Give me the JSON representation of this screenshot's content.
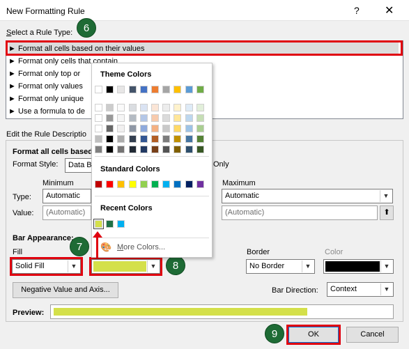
{
  "dialog": {
    "title": "New Formatting Rule",
    "help": "?",
    "close": "✕"
  },
  "select_rule": {
    "label": "Select a Rule Type:",
    "rules": [
      "► Format all cells based on their values",
      "► Format only cells that contain",
      "► Format only top or",
      "► Format only values",
      "► Format only unique",
      "► Use a formula to de"
    ]
  },
  "edit": {
    "label": "Edit the Rule Descriptio",
    "heading": "Format all cells based",
    "format_style_label": "Format Style:",
    "format_style_value": "Data B",
    "only_text": "Only",
    "minimum_label": "Minimum",
    "maximum_label": "Maximum",
    "type_label": "Type:",
    "min_type": "Automatic",
    "max_type": "Automatic",
    "value_label": "Value:",
    "min_value": "(Automatic)",
    "max_value": "(Automatic)",
    "bar_appearance": "Bar Appearance:",
    "fill_label": "Fill",
    "fill_value": "Solid Fill",
    "border_label": "Border",
    "border_value": "No Border",
    "color_label": "Color",
    "negative_button": "Negative Value and Axis...",
    "bar_direction_label": "Bar Direction:",
    "bar_direction_value": "Context",
    "preview_label": "Preview:"
  },
  "colors": {
    "fill_color": "#d4e04a",
    "border_color": "#000000",
    "accent_red": "#e0000f",
    "circle_green": "#1e6b35"
  },
  "palette": {
    "theme_title": "Theme Colors",
    "standard_title": "Standard Colors",
    "recent_title": "Recent Colors",
    "more_colors": "More Colors...",
    "theme_base": [
      "#ffffff",
      "#000000",
      "#e7e6e6",
      "#44546a",
      "#4472c4",
      "#ed7d31",
      "#a5a5a5",
      "#ffc000",
      "#5b9bd5",
      "#70ad47"
    ],
    "standard": [
      "#c00000",
      "#ff0000",
      "#ffc000",
      "#ffff00",
      "#92d050",
      "#00b050",
      "#00b0f0",
      "#0070c0",
      "#002060",
      "#7030a0"
    ],
    "recent": [
      "#d4e04a",
      "#1e7145",
      "#00b0f0"
    ]
  },
  "steps": [
    "6",
    "7",
    "8",
    "9"
  ],
  "buttons": {
    "ok": "OK",
    "cancel": "Cancel"
  }
}
